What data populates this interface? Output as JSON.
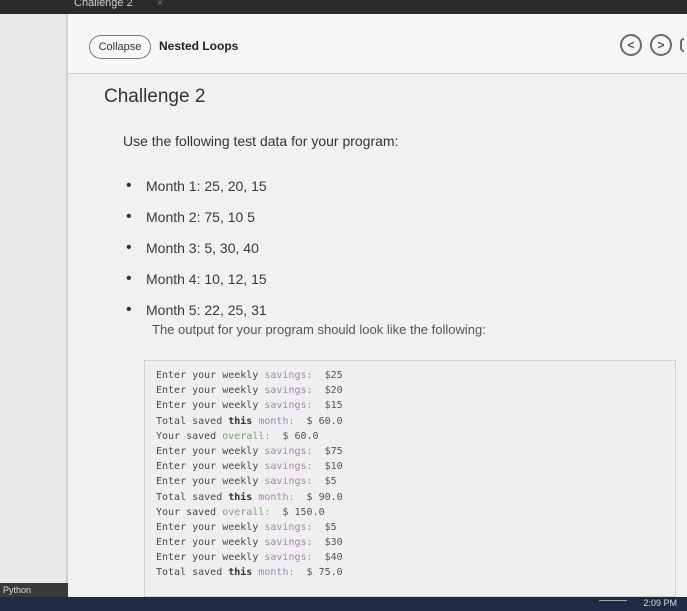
{
  "window": {
    "tab_title": "Challenge 2",
    "tab_close": "×"
  },
  "sidebar": {
    "language": "Python"
  },
  "header": {
    "collapse_label": "Collapse",
    "title": "Nested Loops",
    "prev_icon": "<",
    "next_icon": ">"
  },
  "content": {
    "title": "Challenge 2",
    "intro": "Use the following test data for your program:",
    "months": [
      "Month 1: 25, 20, 15",
      "Month 2: 75, 10 5",
      "Month 3: 5, 30, 40",
      "Month 4: 10, 12, 15",
      "Month 5: 22, 25, 31"
    ],
    "outro": "The output for your program should look like the following:"
  },
  "output": [
    {
      "prefix": "Enter your weekly ",
      "hl": "savings:",
      "value": "  $25",
      "style": "dim"
    },
    {
      "prefix": "Enter your weekly ",
      "hl": "savings:",
      "value": "  $20",
      "style": "dim"
    },
    {
      "prefix": "Enter your weekly ",
      "hl": "savings:",
      "value": "  $15",
      "style": "dim"
    },
    {
      "prefix": "Total saved ",
      "hl": "this",
      "hl2": " month:",
      "value": "  $ 60.0",
      "style": "total"
    },
    {
      "prefix": "Your saved ",
      "hl": "overall:",
      "value": "  $ 60.0",
      "style": "overall"
    },
    {
      "prefix": "Enter your weekly ",
      "hl": "savings:",
      "value": "  $75",
      "style": "dim"
    },
    {
      "prefix": "Enter your weekly ",
      "hl": "savings:",
      "value": "  $10",
      "style": "dim"
    },
    {
      "prefix": "Enter your weekly ",
      "hl": "savings:",
      "value": "  $5",
      "style": "dim"
    },
    {
      "prefix": "Total saved ",
      "hl": "this",
      "hl2": " month:",
      "value": "  $ 90.0",
      "style": "total"
    },
    {
      "prefix": "Your saved ",
      "hl": "overall:",
      "value": "  $ 150.0",
      "style": "overall"
    },
    {
      "prefix": "Enter your weekly ",
      "hl": "savings:",
      "value": "  $5",
      "style": "dim"
    },
    {
      "prefix": "Enter your weekly ",
      "hl": "savings:",
      "value": "  $30",
      "style": "dim"
    },
    {
      "prefix": "Enter your weekly ",
      "hl": "savings:",
      "value": "  $40",
      "style": "dim"
    },
    {
      "prefix": "Total saved ",
      "hl": "this",
      "hl2": " month:",
      "value": "  $ 75.0",
      "style": "total"
    }
  ],
  "taskbar": {
    "time": "2:09 PM"
  },
  "colors": {
    "accent_dim": "#a08aa8",
    "accent_green": "#7fa27a",
    "taskbar": "#1f2a44"
  }
}
